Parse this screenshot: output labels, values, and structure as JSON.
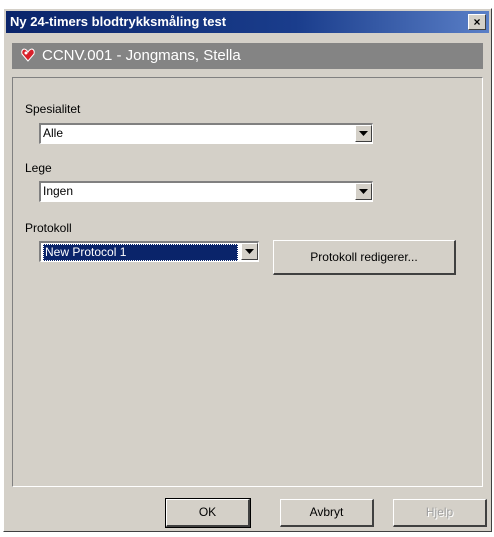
{
  "window": {
    "title": "Ny 24-timers blodtrykksmåling test",
    "close_label": "×"
  },
  "patient": {
    "text": "CCNV.001 - Jongmans, Stella"
  },
  "form": {
    "spesialitet": {
      "label": "Spesialitet",
      "value": "Alle"
    },
    "lege": {
      "label": "Lege",
      "value": "Ingen"
    },
    "protokoll": {
      "label": "Protokoll",
      "value": "New Protocol 1",
      "edit_button": "Protokoll redigerer..."
    }
  },
  "footer": {
    "ok": "OK",
    "cancel": "Avbryt",
    "help": "Hjelp"
  },
  "colors": {
    "title_bar": "#0a246a",
    "patient_bar": "#848484",
    "dialog_bg": "#d4d0c8",
    "selection": "#0a246a"
  }
}
